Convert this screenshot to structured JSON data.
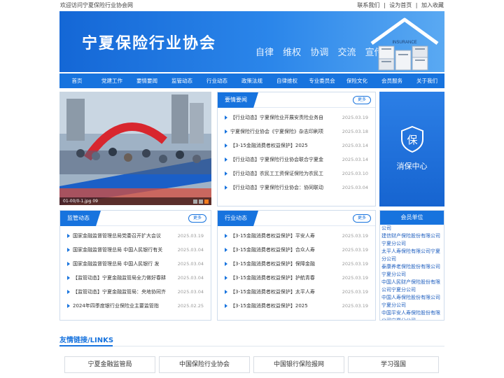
{
  "topbar": {
    "welcome": "欢迎访问宁夏保险行业协会网",
    "contact": "联系我们",
    "homepage": "设为首页",
    "favorite": "加入收藏",
    "sep": "|"
  },
  "banner": {
    "title": "宁夏保险行业协会",
    "slogans": [
      "自律",
      "维权",
      "协调",
      "交流",
      "宣传"
    ],
    "umbrella_label": "INSURANCE"
  },
  "nav": [
    "首页",
    "党建工作",
    "要情要闻",
    "监管动态",
    "行业动态",
    "政策法规",
    "自律维权",
    "专业委员会",
    "保险文化",
    "会员服务",
    "关于我们"
  ],
  "photo": {
    "caption": "01-00/0-1.jpg 09"
  },
  "yaoqing": {
    "title": "要情要闻",
    "more": "更多",
    "items": [
      {
        "t": "【行业动态】宁夏保险业开展安责险业务自",
        "d": "2025.03.19"
      },
      {
        "t": "宁夏保险行业协会《宁夏保险》杂志印刷项",
        "d": "2025.03.18"
      },
      {
        "t": "【3-15金融消费者权益保护】2025",
        "d": "2025.03.14"
      },
      {
        "t": "【行业动态】宁夏保险行业协会联合宁夏金",
        "d": "2025.03.14"
      },
      {
        "t": "【行业动态】农民工工资保证保险为农民工",
        "d": "2025.03.10"
      },
      {
        "t": "【行业动态】宁夏保险行业协会：协同联动",
        "d": "2025.03.04"
      }
    ]
  },
  "service": {
    "icon_char": "保",
    "label": "消保中心"
  },
  "jianguan": {
    "title": "监管动态",
    "more": "更多",
    "items": [
      {
        "t": "国家金融监督管理总局党委召开扩大会议",
        "d": "2025.03.19"
      },
      {
        "t": "国家金融监督管理总局 中国人民银行有关",
        "d": "2025.03.04"
      },
      {
        "t": "国家金融监督管理总局 中国人民银行 发",
        "d": "2025.03.04"
      },
      {
        "t": "【监管动态】宁夏金融监管局全力做好春耕",
        "d": "2025.03.04"
      },
      {
        "t": "【监管动态】宁夏金融监管局：央地协同齐",
        "d": "2025.03.04"
      },
      {
        "t": "2024年四季度银行业保险业主要监管指",
        "d": "2025.02.25"
      }
    ]
  },
  "hangye": {
    "title": "行业动态",
    "more": "更多",
    "items": [
      {
        "t": "【3-15金融消费者权益保护】平安人寿",
        "d": "2025.03.19"
      },
      {
        "t": "【3-15金融消费者权益保护】合众人寿",
        "d": "2025.03.19"
      },
      {
        "t": "【3-15金融消费者权益保护】保障金融",
        "d": "2025.03.19"
      },
      {
        "t": "【3-15金融消费者权益保护】护航青春",
        "d": "2025.03.19"
      },
      {
        "t": "【3-15金融消费者权益保护】太平人寿",
        "d": "2025.03.19"
      },
      {
        "t": "【3-15金融消费者权益保护】2025",
        "d": "2025.03.19"
      }
    ]
  },
  "members": {
    "title": "会员单位",
    "items": [
      "公司",
      "建信财产保险股份有限公司宁夏分公司",
      "太平人寿保险有限公司宁夏分公司",
      "泰康养老保险股份有限公司宁夏分公司",
      "中国人民财产保险股份有限公司宁夏分公司",
      "中国人寿保险股份有限公司宁夏分公司",
      "中国平安人寿保险股份有限公司宁夏分公司"
    ]
  },
  "links": {
    "title": "友情链接/LINKS",
    "items": [
      "宁夏金融监管局",
      "中国保险行业协会",
      "中国银行保险报网",
      "学习强国"
    ]
  },
  "colors": {
    "primary": "#1773de",
    "nav_active": "#0e5cc0",
    "date": "#999999",
    "member_link": "#1f5fbf"
  }
}
